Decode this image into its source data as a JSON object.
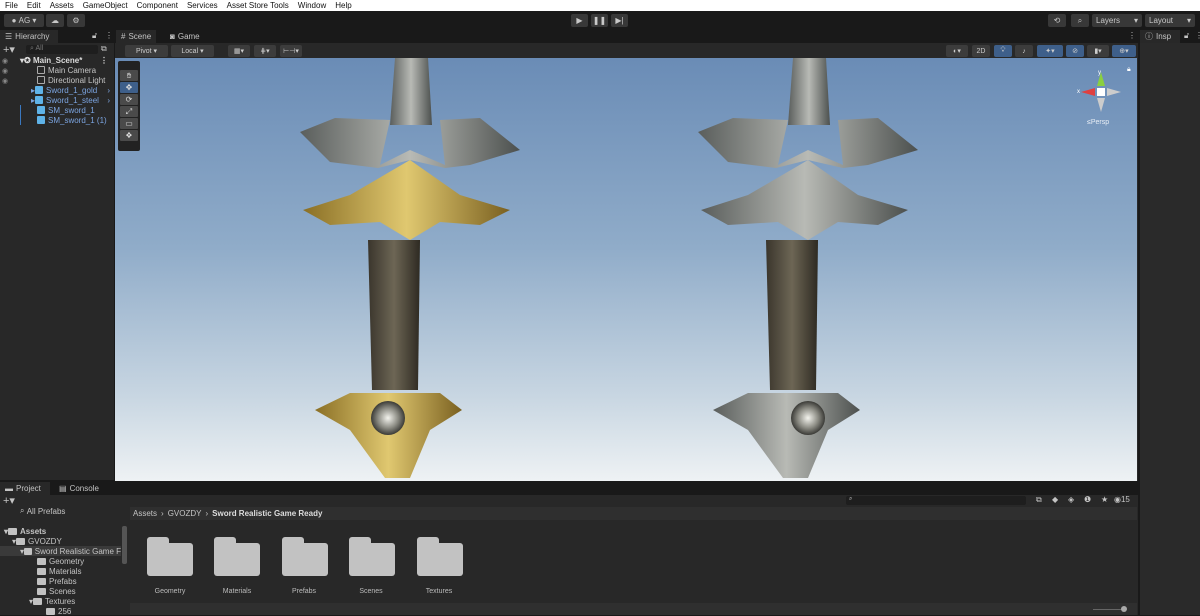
{
  "menu": [
    "File",
    "Edit",
    "Assets",
    "GameObject",
    "Component",
    "Services",
    "Asset Store Tools",
    "Window",
    "Help"
  ],
  "toolbar": {
    "account": "AG ▾",
    "layers": "Layers",
    "layout": "Layout"
  },
  "hierarchy": {
    "tab": "Hierarchy",
    "search_placeholder": "All",
    "scene": "Main_Scene*",
    "items": [
      "Main Camera",
      "Directional Light",
      "Sword_1_gold",
      "Sword_1_steel",
      "SM_sword_1",
      "SM_sword_1 (1)"
    ]
  },
  "scene": {
    "tabs": [
      "Scene",
      "Game"
    ],
    "pivot": "Pivot",
    "local": "Local",
    "mode_2d": "2D",
    "persp": "Persp",
    "gizmo_x": "x",
    "gizmo_y": "y"
  },
  "inspector": {
    "tab": "Insp"
  },
  "project": {
    "tabs": [
      "Project",
      "Console"
    ],
    "search_label": "All Prefabs",
    "breadcrumb": [
      "Assets",
      "GVOZDY",
      "Sword Realistic Game Ready"
    ],
    "hidden_count": "15",
    "tree": [
      "Assets",
      "GVOZDY",
      "Sword Realistic Game F",
      "Geometry",
      "Materials",
      "Prefabs",
      "Scenes",
      "Textures",
      "256"
    ],
    "folders": [
      "Geometry",
      "Materials",
      "Prefabs",
      "Scenes",
      "Textures"
    ]
  },
  "colors": {
    "accent": "#3e5f8a",
    "gold": "#c9a640",
    "steel": "#9a9c9a"
  }
}
